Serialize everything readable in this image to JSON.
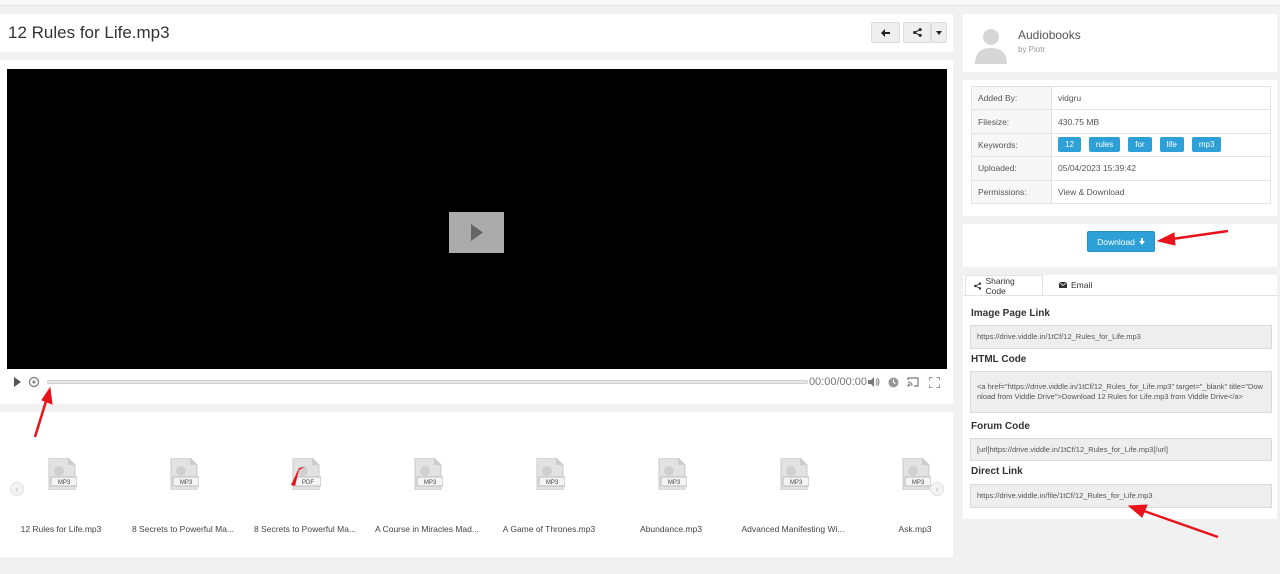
{
  "header": {
    "title": "12 Rules for Life.mp3"
  },
  "player": {
    "time": "00:00/00:00"
  },
  "thumbnails": [
    {
      "label": "12 Rules for Life.mp3",
      "type": "MP3"
    },
    {
      "label": "8 Secrets to Powerful Ma...",
      "type": "MP3"
    },
    {
      "label": "8 Secrets to Powerful Ma...",
      "type": "PDF"
    },
    {
      "label": "A Course in Miracles Mad...",
      "type": "MP3"
    },
    {
      "label": "A Game of Thrones.mp3",
      "type": "MP3"
    },
    {
      "label": "Abundance.mp3",
      "type": "MP3"
    },
    {
      "label": "Advanced Manifesting Wi...",
      "type": "MP3"
    },
    {
      "label": "Ask.mp3",
      "type": "MP3"
    }
  ],
  "owner": {
    "name": "Audiobooks",
    "by": "by Piotr"
  },
  "info": {
    "added_by_label": "Added By:",
    "added_by": "vidgru",
    "filesize_label": "Filesize:",
    "filesize": "430.75 MB",
    "keywords_label": "Keywords:",
    "keywords": [
      "12",
      "rules",
      "for",
      "life",
      "mp3"
    ],
    "uploaded_label": "Uploaded:",
    "uploaded": "05/04/2023 15:39:42",
    "permissions_label": "Permissions:",
    "permissions": "View & Download"
  },
  "download": {
    "label": "Download"
  },
  "sharing": {
    "tab_sharing": "Sharing Code",
    "tab_email": "Email",
    "image_page_link_label": "Image Page Link",
    "image_page_link": "https://drive.viddle.in/1tCf/12_Rules_for_Life.mp3",
    "html_code_label": "HTML Code",
    "html_code": "<a href=\"https://drive.viddle.in/1tCf/12_Rules_for_Life.mp3\" target=\"_blank\" title=\"Download from Viddle Drive\">Download 12 Rules for Life.mp3 from Viddle Drive</a>",
    "forum_code_label": "Forum Code",
    "forum_code": "[url]https://drive.viddle.in/1tCf/12_Rules_for_Life.mp3[/url]",
    "direct_link_label": "Direct Link",
    "direct_link": "https://drive.viddle.in/file/1tCf/12_Rules_for_Life.mp3"
  },
  "colors": {
    "accent": "#2da0d8",
    "annotation": "#e8131b"
  }
}
